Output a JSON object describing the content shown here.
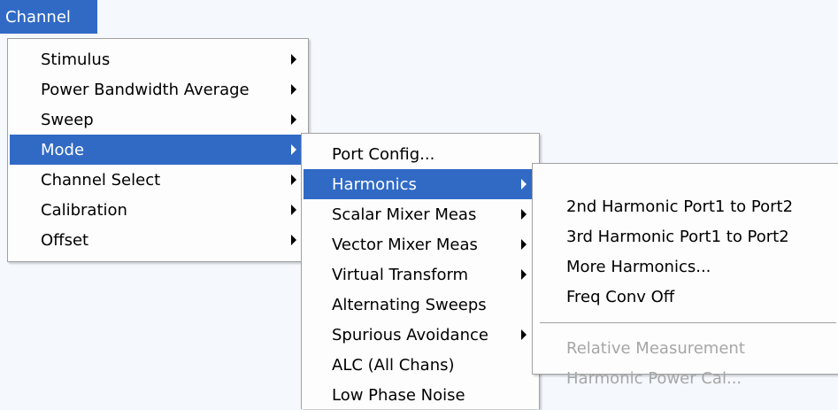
{
  "menubar": {
    "channel": "Channel"
  },
  "channel_menu": {
    "items": [
      {
        "label": "Stimulus"
      },
      {
        "label": "Power Bandwidth Average"
      },
      {
        "label": "Sweep"
      },
      {
        "label": "Mode"
      },
      {
        "label": "Channel Select"
      },
      {
        "label": "Calibration"
      },
      {
        "label": "Offset"
      }
    ]
  },
  "mode_menu": {
    "items": [
      {
        "label": "Port Config..."
      },
      {
        "label": "Harmonics"
      },
      {
        "label": "Scalar Mixer Meas"
      },
      {
        "label": "Vector Mixer Meas"
      },
      {
        "label": "Virtual Transform"
      },
      {
        "label": "Alternating Sweeps"
      },
      {
        "label": "Spurious Avoidance"
      },
      {
        "label": "ALC (All Chans)"
      },
      {
        "label": "Low Phase Noise"
      }
    ]
  },
  "harmonics_menu": {
    "items": [
      {
        "label": "2nd Harmonic Port1 to Port2"
      },
      {
        "label": "3rd Harmonic Port1 to Port2"
      },
      {
        "label": "More Harmonics..."
      },
      {
        "label": "Freq Conv Off"
      },
      {
        "label": "Relative Measurement"
      },
      {
        "label": "Harmonic Power Cal..."
      }
    ]
  },
  "colors": {
    "highlight": "#316ac5",
    "disabled_text": "#a6a6a6",
    "background": "#f5f8fd"
  }
}
